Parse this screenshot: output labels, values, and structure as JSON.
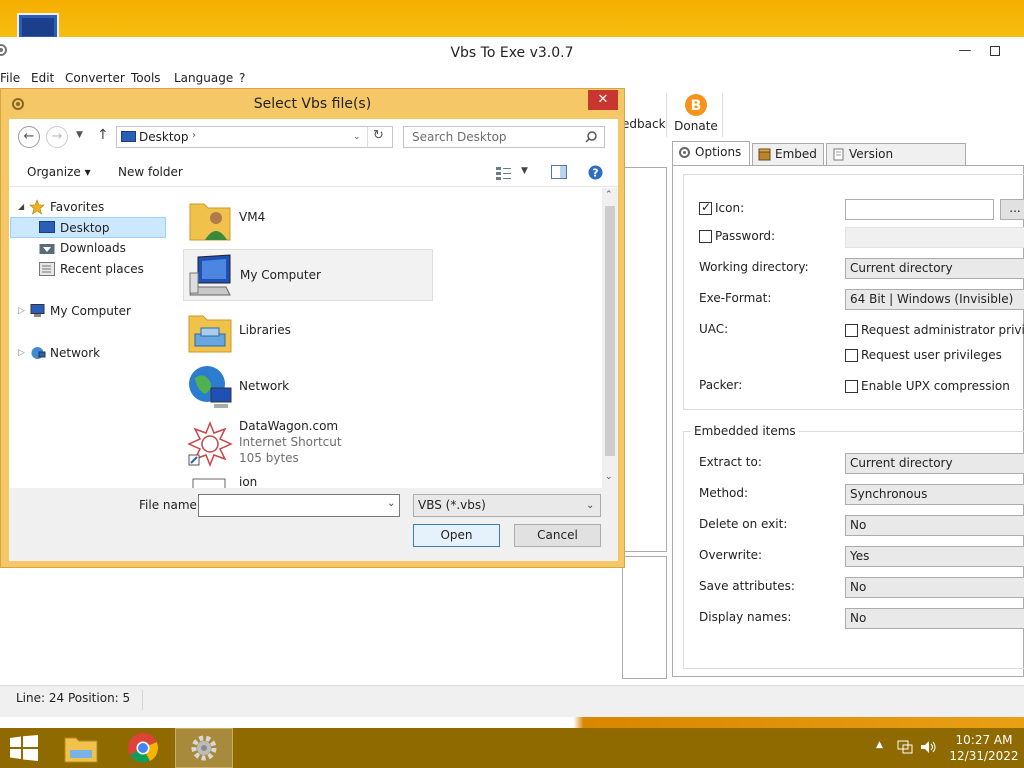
{
  "app": {
    "title": "Vbs To Exe v3.0.7"
  },
  "menu": [
    "File",
    "Edit",
    "Converter",
    "Tools",
    "Language",
    "?"
  ],
  "toolbar": {
    "feedback_label": "edback",
    "donate_label": "Donate"
  },
  "tabs": [
    {
      "label": "Options",
      "icon": "gear-icon",
      "active": true
    },
    {
      "label": "Embed",
      "icon": "box-icon",
      "active": false
    },
    {
      "label": "Version information",
      "icon": "document-icon",
      "active": false
    }
  ],
  "options": {
    "icon_label": "Icon:",
    "icon_checked": true,
    "icon_value": "",
    "icon_browse": "...",
    "password_label": "Password:",
    "password_checked": false,
    "workdir_label": "Working directory:",
    "workdir_value": "Current directory",
    "exeformat_label": "Exe-Format:",
    "exeformat_value": "64 Bit | Windows (Invisible)",
    "uac_label": "UAC:",
    "uac_admin": "Request administrator privile",
    "uac_user": "Request user privileges",
    "packer_label": "Packer:",
    "packer_upx": "Enable UPX compression"
  },
  "embedded": {
    "title": "Embedded items",
    "extract_label": "Extract to:",
    "extract_value": "Current directory",
    "method_label": "Method:",
    "method_value": "Synchronous",
    "delete_label": "Delete on exit:",
    "delete_value": "No",
    "overwrite_label": "Overwrite:",
    "overwrite_value": "Yes",
    "saveattr_label": "Save attributes:",
    "saveattr_value": "No",
    "displaynames_label": "Display names:",
    "displaynames_value": "No"
  },
  "status": {
    "text": "Line: 24  Position: 5"
  },
  "dialog": {
    "title": "Select Vbs file(s)",
    "close": "✕",
    "address": "Desktop",
    "search_placeholder": "Search Desktop",
    "organize": "Organize ▾",
    "new_folder": "New folder",
    "nav": [
      {
        "label": "Favorites",
        "icon": "star-icon"
      },
      {
        "label": "Desktop",
        "icon": "desktop-icon",
        "selected": true
      },
      {
        "label": "Downloads",
        "icon": "downloads-icon"
      },
      {
        "label": "Recent places",
        "icon": "recent-places-icon"
      },
      {
        "label": "My Computer",
        "icon": "computer-icon"
      },
      {
        "label": "Network",
        "icon": "network-icon"
      }
    ],
    "files": [
      {
        "name": "VM4",
        "icon": "user-folder-icon"
      },
      {
        "name": "My Computer",
        "icon": "computer-icon"
      },
      {
        "name": "Libraries",
        "icon": "libraries-folder-icon"
      },
      {
        "name": "Network",
        "icon": "network-globe-icon"
      },
      {
        "name": "DataWagon.com",
        "sub1": "Internet Shortcut",
        "sub2": "105 bytes",
        "icon": "internet-shortcut-icon"
      },
      {
        "name": "ion",
        "icon": "file-icon"
      }
    ],
    "filename_label": "File name:",
    "filename_value": "",
    "filetype_value": "VBS (*.vbs)",
    "open_label": "Open",
    "cancel_label": "Cancel"
  },
  "taskbar": {
    "time": "10:27 AM",
    "date": "12/31/2022"
  }
}
